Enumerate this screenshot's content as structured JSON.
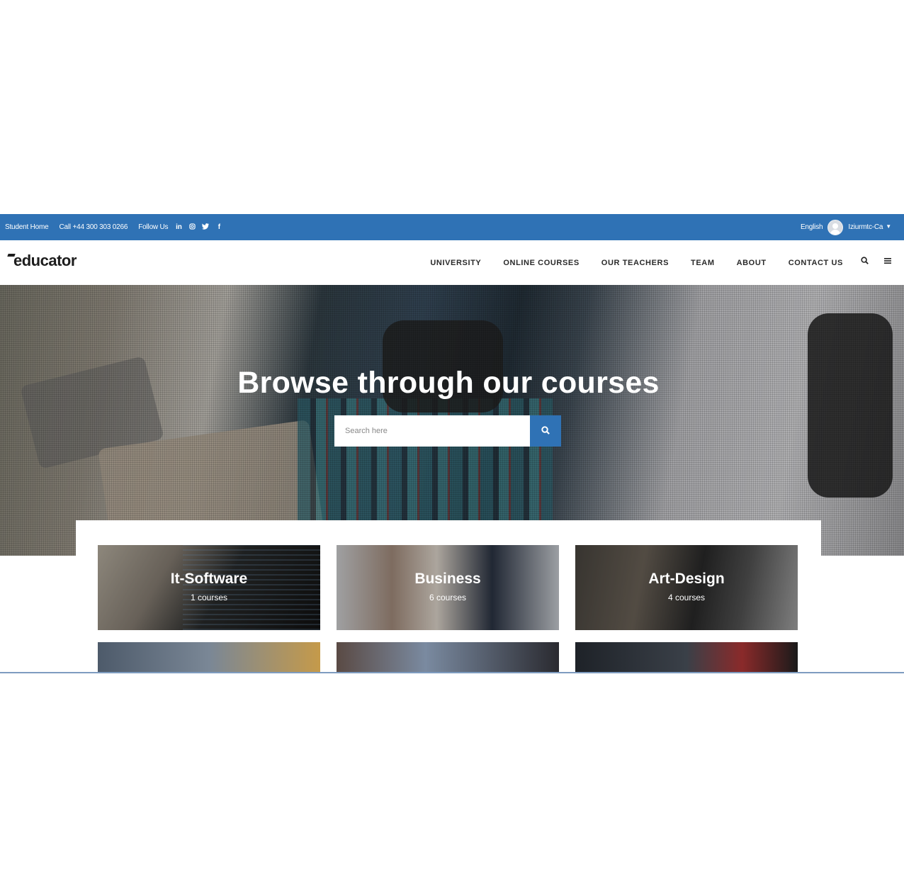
{
  "topbar": {
    "student_home": "Student Home",
    "phone": "Call +44 300 303 0266",
    "follow_us": "Follow Us",
    "social_icons": [
      "linkedin-icon",
      "instagram-icon",
      "twitter-icon",
      "facebook-icon"
    ],
    "language": "English",
    "user_name": "Iziurmtc-Ca",
    "bg_color": "#2f72b5"
  },
  "header": {
    "logo_text": "educator",
    "nav": [
      "UNIVERSITY",
      "ONLINE COURSES",
      "OUR TEACHERS",
      "TEAM",
      "ABOUT",
      "CONTACT US"
    ]
  },
  "hero": {
    "title": "Browse through our courses",
    "search_placeholder": "Search here"
  },
  "categories": [
    {
      "title": "It-Software",
      "count": "1 courses"
    },
    {
      "title": "Business",
      "count": "6 courses"
    },
    {
      "title": "Art-Design",
      "count": "4 courses"
    }
  ],
  "accent_color": "#2f72b5"
}
